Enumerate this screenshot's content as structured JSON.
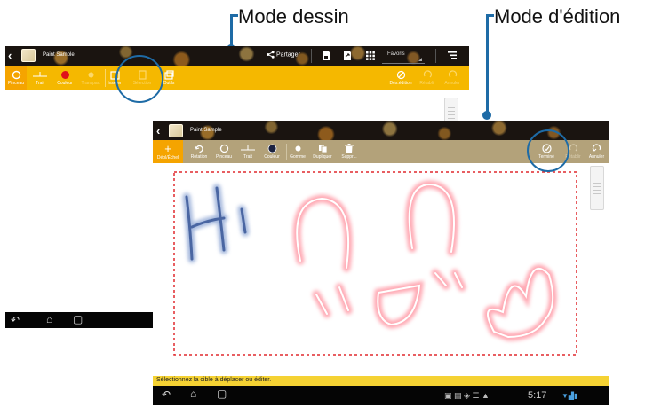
{
  "callouts": {
    "draw_mode": "Mode dessin",
    "edit_mode": "Mode d'édition"
  },
  "app_title": "Paint Sample",
  "draw_screen": {
    "actionbar": {
      "share_label": "Partager",
      "favorites_label": "Favoris"
    },
    "tools": {
      "brush": "Pinceau",
      "line": "Trait",
      "color": "Couleur",
      "transparency": "Transpar.",
      "insert": "Insérer",
      "edit": "Sélection",
      "tools": "Outils",
      "edit_tool": "Dés.édition",
      "redo": "Rétablir",
      "undo": "Annuler"
    }
  },
  "edit_screen": {
    "tools": {
      "move": "Dépl/Échel",
      "rotate": "Rotation",
      "brush": "Pinceau",
      "line": "Trait",
      "color": "Couleur",
      "eraser": "Gomme",
      "duplicate": "Dupliquer",
      "delete": "Suppr...",
      "done": "Terminé",
      "redo": "Rétablir",
      "undo": "Annuler"
    },
    "status_text": "Sélectionnez la cible à déplacer ou éditer.",
    "clock": "5:17"
  },
  "colors": {
    "accent_yellow": "#f5a400",
    "edit_toolbar": "#b3a27a",
    "callout_blue": "#1e6ba6",
    "selection_red": "#e0282e",
    "ink_blue": "#5a78b0",
    "ink_red": "#f05a6a"
  },
  "icons": [
    "back-chevron-icon",
    "share-icon",
    "save-icon",
    "export-icon",
    "grid-icon",
    "menu-icon",
    "brush-icon",
    "line-icon",
    "color-icon",
    "transparency-icon",
    "insert-icon",
    "select-icon",
    "tools-icon",
    "edit-icon",
    "redo-icon",
    "undo-icon",
    "move-icon",
    "rotate-icon",
    "eraser-icon",
    "duplicate-icon",
    "trash-icon",
    "check-icon",
    "home-icon",
    "recent-apps-icon"
  ]
}
